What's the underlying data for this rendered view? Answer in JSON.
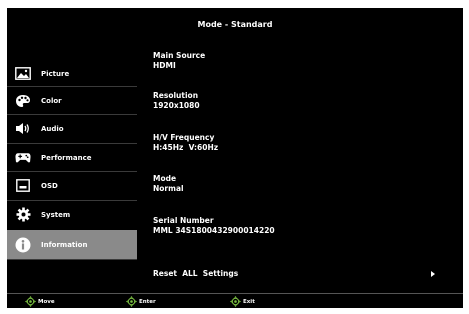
{
  "header": {
    "title": "Mode - Standard"
  },
  "sidebar": {
    "items": [
      {
        "label": "Picture",
        "icon": "picture-icon"
      },
      {
        "label": "Color",
        "icon": "palette-icon"
      },
      {
        "label": "Audio",
        "icon": "speaker-icon"
      },
      {
        "label": "Performance",
        "icon": "gamepad-icon"
      },
      {
        "label": "OSD",
        "icon": "osd-icon"
      },
      {
        "label": "System",
        "icon": "gear-icon"
      },
      {
        "label": "Information",
        "icon": "info-icon",
        "active": true
      }
    ]
  },
  "info": {
    "main_source_label": "Main Source",
    "main_source_value": "HDMI",
    "resolution_label": "Resolution",
    "resolution_value": "1920x1080",
    "hv_label": "H/V Frequency",
    "hv_value": "H:45Hz  V:60Hz",
    "mode_label": "Mode",
    "mode_value": "Normal",
    "serial_label": "Serial Number",
    "serial_value": "MML 34S1800432900014220"
  },
  "reset": {
    "label": "Reset  ALL  Settings"
  },
  "footer": {
    "move": "Move",
    "enter": "Enter",
    "exit": "Exit"
  },
  "colors": {
    "background": "#000000",
    "active_item": "#8a8a8a",
    "dpad_green": "#7cc242",
    "text": "#ffffff"
  }
}
